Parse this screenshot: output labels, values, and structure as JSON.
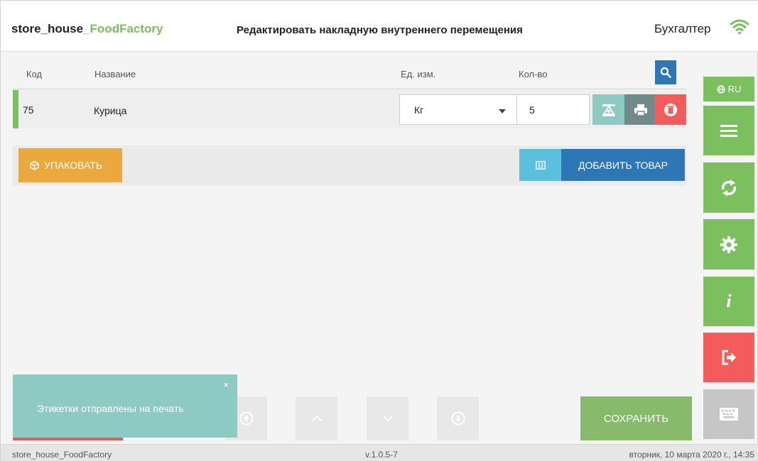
{
  "header": {
    "brand_main": "store_house",
    "brand_accent": "_FoodFactory",
    "title": "Редактировать накладную внутреннего перемещения",
    "user_role": "Бухгалтер"
  },
  "table": {
    "columns": {
      "code": "Код",
      "name": "Название",
      "unit": "Ед. изм.",
      "qty": "Кол-во"
    },
    "rows": [
      {
        "code": "75",
        "name": "Курица",
        "unit": "Кг",
        "qty": "5"
      }
    ]
  },
  "actions": {
    "pack_label": "УПАКОВАТЬ",
    "add_product_label": "ДОБАВИТЬ ТОВАР"
  },
  "sidebar": {
    "lang_label": "RU",
    "items": [
      "menu-icon",
      "sync-icon",
      "gear-icon",
      "info-icon",
      "logout-icon",
      "keyboard-icon"
    ]
  },
  "bottom": {
    "save_label": "СОХРАНИТЬ"
  },
  "toast": {
    "message": "Этикетки отправлены на печать",
    "close": "×"
  },
  "footer": {
    "app": "store_house_FoodFactory",
    "version": "v.1.0.5-7",
    "datetime": "вторник, 10 марта 2020 г., 14:35"
  },
  "colors": {
    "brand_green": "#7bbf5e",
    "primary_blue": "#2e77b7",
    "orange": "#eaa83e",
    "red": "#f45b5b",
    "teal": "#8fc9c4"
  }
}
